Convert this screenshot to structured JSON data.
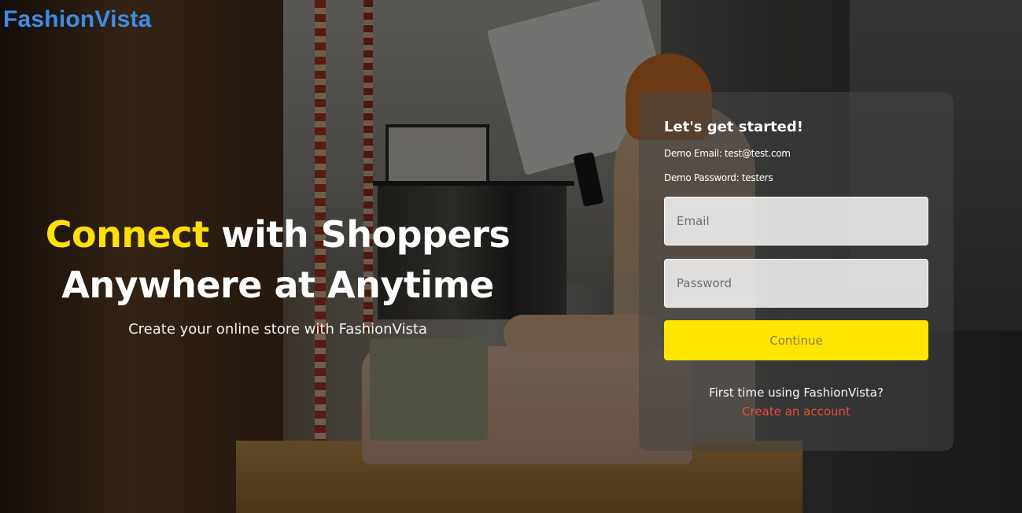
{
  "brand": {
    "name": "FashionVista",
    "color": "#3d8de8"
  },
  "hero": {
    "accent_word": "Connect",
    "line1_rest": " with Shoppers",
    "line2": "Anywhere at Anytime",
    "subtitle": "Create your online store with FashionVista",
    "accent_color": "#ffe000"
  },
  "login": {
    "title": "Let's get started!",
    "demo_email": "Demo Email: test@test.com",
    "demo_password": "Demo Password: testers",
    "email_placeholder": "Email",
    "password_placeholder": "Password",
    "continue_label": "Continue",
    "signup_prompt": "First time using FashionVista?",
    "signup_link": "Create an account",
    "button_color": "#ffe600",
    "link_color": "#e8513a"
  }
}
